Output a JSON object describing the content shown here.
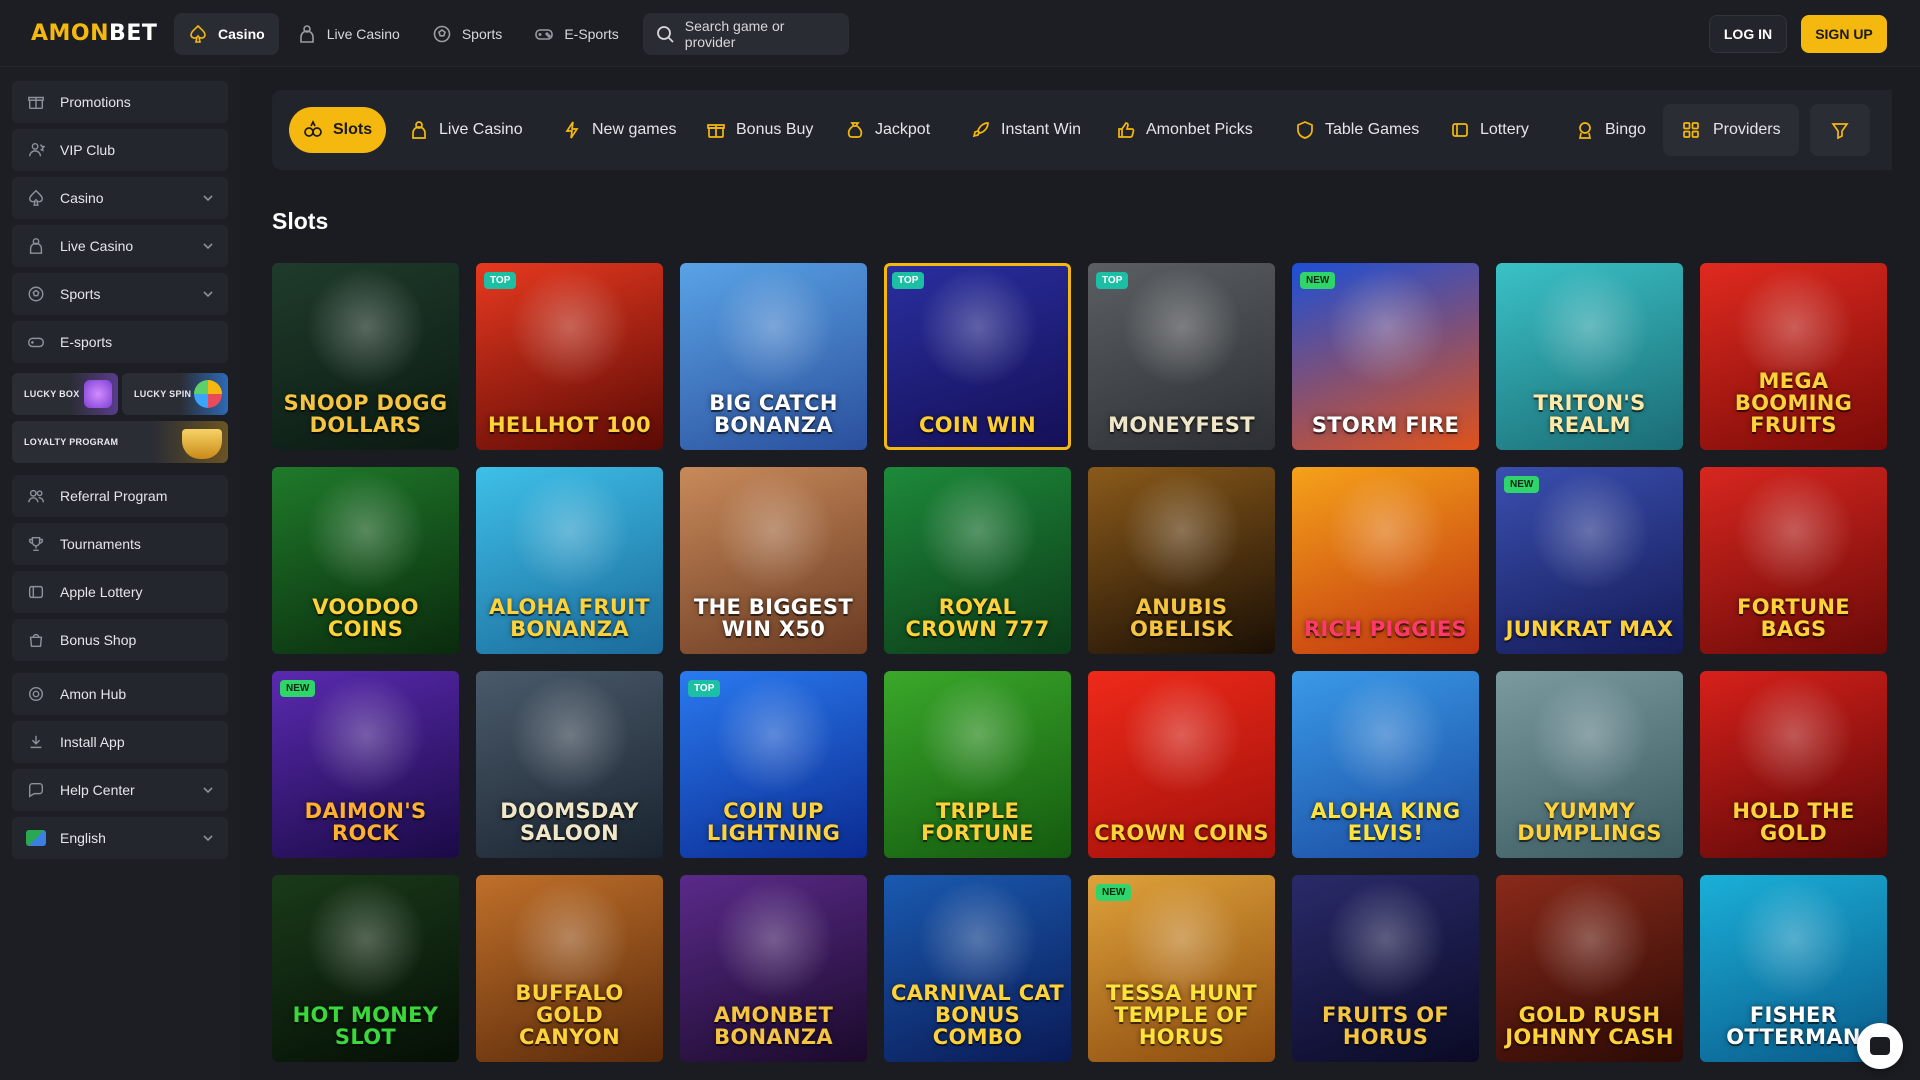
{
  "brand": {
    "logo_a": "AMON",
    "logo_b": "BET"
  },
  "topnav": [
    {
      "label": "Casino",
      "icon": "spade-icon",
      "active": true
    },
    {
      "label": "Live Casino",
      "icon": "dealer-icon",
      "active": false
    },
    {
      "label": "Sports",
      "icon": "soccer-ball-icon",
      "active": false
    },
    {
      "label": "E-Sports",
      "icon": "gamepad-icon",
      "active": false
    }
  ],
  "search": {
    "placeholder": "Search game or provider"
  },
  "auth": {
    "login": "LOG IN",
    "signup": "SIGN UP"
  },
  "sidebar": {
    "items": [
      {
        "label": "Promotions",
        "icon": "gift-icon"
      },
      {
        "label": "VIP Club",
        "icon": "vip-icon"
      },
      {
        "label": "Casino",
        "icon": "spade-icon",
        "expandable": true
      },
      {
        "label": "Live Casino",
        "icon": "dealer-icon",
        "expandable": true
      },
      {
        "label": "Sports",
        "icon": "soccer-ball-icon",
        "expandable": true
      },
      {
        "label": "E-sports",
        "icon": "gamepad-icon"
      }
    ],
    "promos": {
      "lucky_box": "LUCKY BOX",
      "lucky_spin": "LUCKY SPIN",
      "loyalty": "LOYALTY PROGRAM"
    },
    "items2": [
      {
        "label": "Referral Program",
        "icon": "users-icon"
      },
      {
        "label": "Tournaments",
        "icon": "trophy-icon"
      },
      {
        "label": "Apple Lottery",
        "icon": "ticket-icon"
      },
      {
        "label": "Bonus Shop",
        "icon": "shop-icon"
      }
    ],
    "items3": [
      {
        "label": "Amon Hub",
        "icon": "hub-icon"
      },
      {
        "label": "Install App",
        "icon": "download-icon"
      },
      {
        "label": "Help Center",
        "icon": "help-icon",
        "expandable": true
      },
      {
        "label": "English",
        "icon": "flag-icon",
        "expandable": true
      }
    ]
  },
  "categories": [
    {
      "label": "Slots",
      "icon": "slots-icon",
      "active": true
    },
    {
      "label": "Live Casino",
      "icon": "dealer-icon"
    },
    {
      "label": "New games",
      "icon": "lightning-icon"
    },
    {
      "label": "Bonus Buy",
      "icon": "gift-box-icon"
    },
    {
      "label": "Jackpot",
      "icon": "money-bag-icon"
    },
    {
      "label": "Instant Win",
      "icon": "rocket-icon"
    },
    {
      "label": "Amonbet Picks",
      "icon": "thumbs-up-icon"
    },
    {
      "label": "Table Games",
      "icon": "shield-icon"
    },
    {
      "label": "Lottery",
      "icon": "ticket-icon"
    },
    {
      "label": "Bingo",
      "icon": "bingo-icon"
    }
  ],
  "providers_label": "Providers",
  "section_title": "Slots",
  "games": [
    {
      "title": "Snoop Dogg Dollars",
      "badge": "",
      "colors": [
        "#1f3b2b",
        "#0b1a12"
      ],
      "text": "#f5c542"
    },
    {
      "title": "HellHot 100",
      "badge": "TOP",
      "colors": [
        "#e8391f",
        "#5a0a05"
      ],
      "text": "#ffd23a"
    },
    {
      "title": "Big Catch Bonanza",
      "badge": "",
      "colors": [
        "#5aa3e6",
        "#2a4f9c"
      ],
      "text": "#ffffff"
    },
    {
      "title": "Coin Win",
      "badge": "TOP",
      "colors": [
        "#2a2fa0",
        "#140f55"
      ],
      "text": "#ffcf2e",
      "highlight": true
    },
    {
      "title": "Moneyfest",
      "badge": "TOP",
      "colors": [
        "#5b5f63",
        "#2c2f33"
      ],
      "text": "#f0e6c8"
    },
    {
      "title": "Storm Fire",
      "badge": "NEW",
      "colors": [
        "#1d4fd6",
        "#e0521a"
      ],
      "text": "#ffffff"
    },
    {
      "title": "Triton's Realm",
      "badge": "",
      "colors": [
        "#3ac2c7",
        "#1b6b74"
      ],
      "text": "#ffe9a6"
    },
    {
      "title": "Mega Booming Fruits",
      "badge": "",
      "colors": [
        "#e02a1f",
        "#7a0b08"
      ],
      "text": "#ffd23a"
    },
    {
      "title": "Voodoo Coins",
      "badge": "",
      "colors": [
        "#1f7a2a",
        "#0a2a0d"
      ],
      "text": "#ffd23a"
    },
    {
      "title": "Aloha Fruit Bonanza",
      "badge": "",
      "colors": [
        "#3ec0e8",
        "#1b6a9a"
      ],
      "text": "#ffd23a"
    },
    {
      "title": "The Biggest Win X50",
      "badge": "",
      "colors": [
        "#c88a5a",
        "#6a3a22"
      ],
      "text": "#ffffff"
    },
    {
      "title": "Royal Crown 777",
      "badge": "",
      "colors": [
        "#1d8a3a",
        "#0c3a18"
      ],
      "text": "#ffd23a"
    },
    {
      "title": "Anubis Obelisk",
      "badge": "",
      "colors": [
        "#8a5a1a",
        "#1a0f05"
      ],
      "text": "#f5c542"
    },
    {
      "title": "Rich Piggies",
      "badge": "",
      "colors": [
        "#f5a21a",
        "#c0330f"
      ],
      "text": "#ff3a6a"
    },
    {
      "title": "Junkrat Max",
      "badge": "NEW",
      "colors": [
        "#3a4fb0",
        "#141a55"
      ],
      "text": "#ffd23a"
    },
    {
      "title": "Fortune Bags",
      "badge": "",
      "colors": [
        "#d8261f",
        "#6a0a08"
      ],
      "text": "#ffd23a"
    },
    {
      "title": "Daimon's Rock",
      "badge": "NEW",
      "colors": [
        "#5a2ab0",
        "#1a0a45"
      ],
      "text": "#ffb02e"
    },
    {
      "title": "Doomsday Saloon",
      "badge": "",
      "colors": [
        "#4a5a6a",
        "#1a2430"
      ],
      "text": "#f0e6c8"
    },
    {
      "title": "Coin Up Lightning",
      "badge": "TOP",
      "colors": [
        "#2a7af0",
        "#0a2a90"
      ],
      "text": "#ffd23a"
    },
    {
      "title": "Triple Fortune",
      "badge": "",
      "colors": [
        "#3aa82a",
        "#145a0f"
      ],
      "text": "#ffd23a"
    },
    {
      "title": "Crown Coins",
      "badge": "",
      "colors": [
        "#ef2a1a",
        "#a0100a"
      ],
      "text": "#ffd23a"
    },
    {
      "title": "Aloha King Elvis!",
      "badge": "",
      "colors": [
        "#3a9ae8",
        "#1a4aa0"
      ],
      "text": "#ffe23a"
    },
    {
      "title": "Yummy Dumplings",
      "badge": "",
      "colors": [
        "#7a9aa0",
        "#3a5a60"
      ],
      "text": "#ffd23a"
    },
    {
      "title": "Hold The Gold",
      "badge": "",
      "colors": [
        "#d8201a",
        "#5a0808"
      ],
      "text": "#ffd23a"
    },
    {
      "title": "Hot Money Slot",
      "badge": "",
      "colors": [
        "#1a3a1a",
        "#050f05"
      ],
      "text": "#3ad83a"
    },
    {
      "title": "Buffalo Gold Canyon",
      "badge": "",
      "colors": [
        "#c0702a",
        "#5a2a0a"
      ],
      "text": "#ffd23a"
    },
    {
      "title": "Amonbet Bonanza",
      "badge": "",
      "colors": [
        "#5a2a8a",
        "#1a0a2a"
      ],
      "text": "#f5c542"
    },
    {
      "title": "Carnival Cat Bonus Combo",
      "badge": "",
      "colors": [
        "#1a5ab0",
        "#0a1a55"
      ],
      "text": "#ffd23a"
    },
    {
      "title": "Tessa Hunt Temple of Horus",
      "badge": "NEW",
      "colors": [
        "#e0a23a",
        "#8a4a0f"
      ],
      "text": "#ffe23a"
    },
    {
      "title": "Fruits of Horus",
      "badge": "",
      "colors": [
        "#2a2a6a",
        "#0a0a25"
      ],
      "text": "#f5c542"
    },
    {
      "title": "Gold Rush Johnny Cash",
      "badge": "",
      "colors": [
        "#8a2a1a",
        "#2a0a05"
      ],
      "text": "#ffd23a"
    },
    {
      "title": "Fisher Otterman",
      "badge": "",
      "colors": [
        "#1ab0d8",
        "#0a5a8a"
      ],
      "text": "#ffffff"
    }
  ]
}
